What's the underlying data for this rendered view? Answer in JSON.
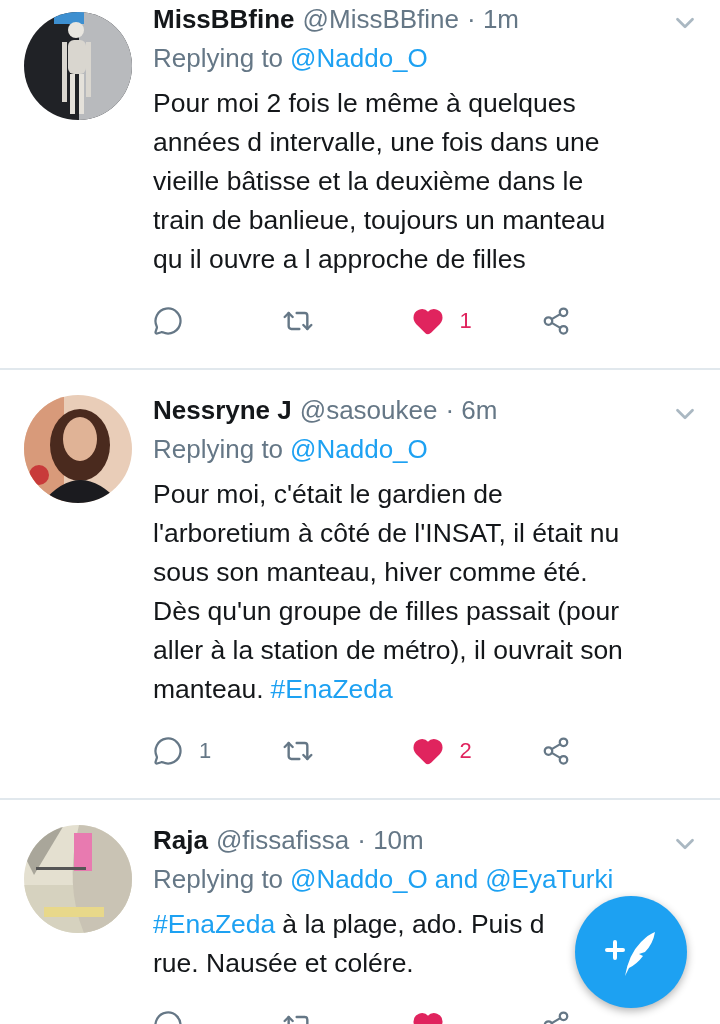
{
  "tweets": [
    {
      "name": "MissBBfine",
      "handle": "@MissBBfine",
      "time": "· 1m",
      "reply": [
        {
          "kind": "plain",
          "text": "Replying to"
        },
        {
          "kind": "link",
          "text": "@Naddo_O"
        }
      ],
      "body": [
        [
          {
            "kind": "plain",
            "text": "Pour moi 2 fois le même à quelques"
          }
        ],
        [
          {
            "kind": "plain",
            "text": "années d intervalle, une fois dans une"
          }
        ],
        [
          {
            "kind": "plain",
            "text": "vieille bâtisse et la deuxième dans le"
          }
        ],
        [
          {
            "kind": "plain",
            "text": "train de banlieue, toujours un manteau"
          }
        ],
        [
          {
            "kind": "plain",
            "text": "qu il ouvre a l approche de filles"
          }
        ]
      ],
      "actions": {
        "likes": "1",
        "liked": true
      }
    },
    {
      "name": "Nessryne J",
      "handle": "@sasoukee",
      "time": "· 6m",
      "reply": [
        {
          "kind": "plain",
          "text": "Replying to"
        },
        {
          "kind": "link",
          "text": "@Naddo_O"
        }
      ],
      "body": [
        [
          {
            "kind": "plain",
            "text": "Pour moi, c'était le gardien de"
          }
        ],
        [
          {
            "kind": "plain",
            "text": "l'arboretium à côté de l'INSAT, il était nu"
          }
        ],
        [
          {
            "kind": "plain",
            "text": "sous son manteau, hiver comme été."
          }
        ],
        [
          {
            "kind": "plain",
            "text": "Dès qu'un groupe de filles passait (pour"
          }
        ],
        [
          {
            "kind": "plain",
            "text": "aller à la station de métro), il ouvrait son"
          }
        ],
        [
          {
            "kind": "plain",
            "text": "manteau."
          },
          {
            "kind": "link",
            "text": "#EnaZeda"
          }
        ]
      ],
      "actions": {
        "replies": "1",
        "likes": "2",
        "liked": true
      }
    },
    {
      "name": "Raja",
      "handle": "@fissafissa",
      "time": "· 10m",
      "reply": [
        {
          "kind": "plain",
          "text": "Replying to"
        },
        {
          "kind": "link",
          "text": "@Naddo_O"
        },
        {
          "kind": "link",
          "text": "and"
        },
        {
          "kind": "link",
          "text": "@EyaTurki"
        }
      ],
      "body": [
        [
          {
            "kind": "link",
            "text": "#EnaZeda"
          },
          {
            "kind": "plain",
            "text": "à la plage, ado. Puis d"
          }
        ],
        [
          {
            "kind": "plain",
            "text": "rue. Nausée et colére."
          }
        ]
      ],
      "actions": {
        "liked": true
      }
    }
  ]
}
